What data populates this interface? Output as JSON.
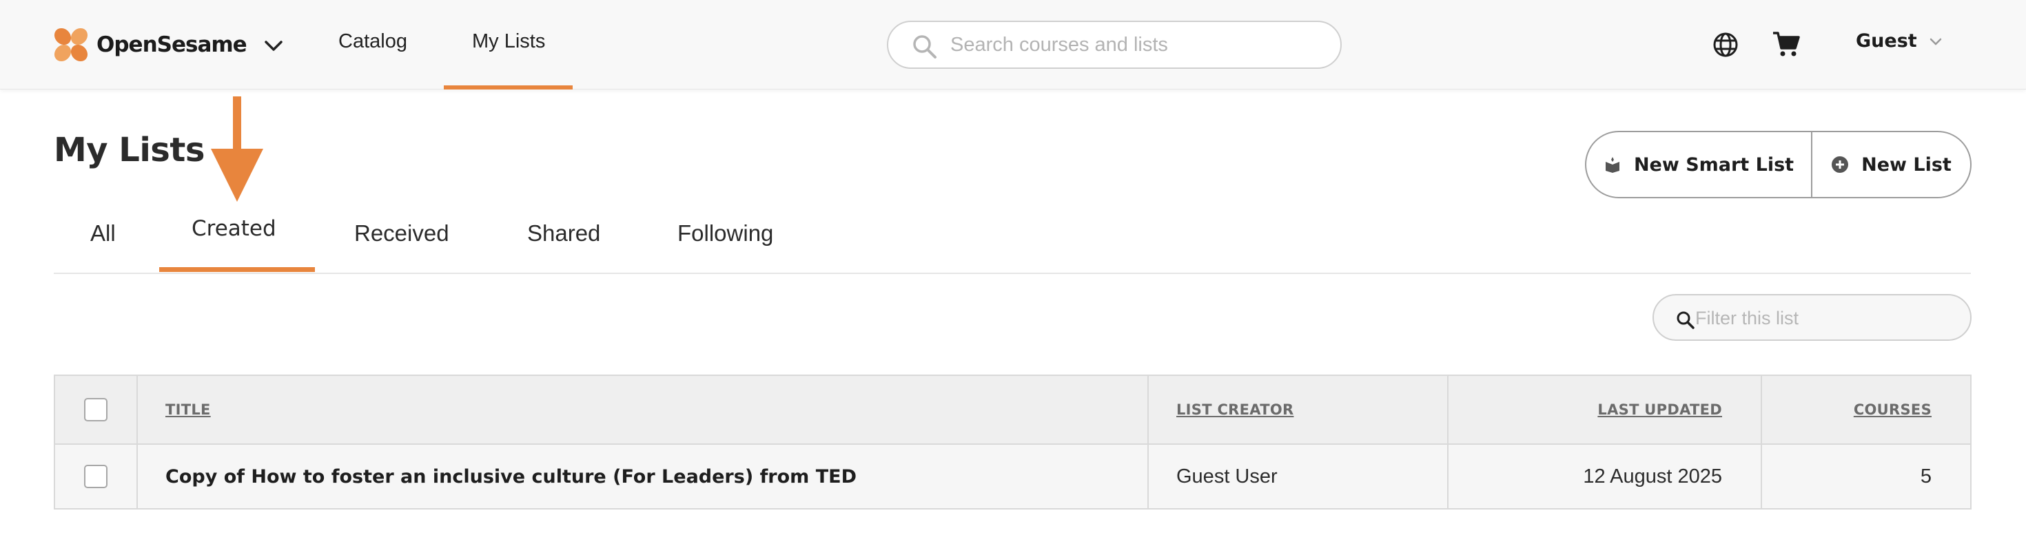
{
  "header": {
    "brand": "OpenSesame",
    "nav": {
      "catalog": "Catalog",
      "my_lists": "My Lists"
    },
    "search": {
      "placeholder": "Search courses and lists",
      "value": ""
    },
    "user": {
      "name": "Guest"
    },
    "colors": {
      "accent": "#e8853d"
    },
    "icons": [
      "opensesame-logo",
      "chevron-down-icon",
      "search-icon",
      "globe-icon",
      "cart-icon"
    ]
  },
  "page": {
    "title": "My Lists",
    "actions": {
      "new_smart_list": "New Smart List",
      "new_list": "New List"
    },
    "tabs": {
      "all": "All",
      "created": "Created",
      "received": "Received",
      "shared": "Shared",
      "following": "Following",
      "active": "Created"
    },
    "filter": {
      "placeholder": "Filter this list",
      "value": ""
    }
  },
  "table": {
    "columns": {
      "title": "TITLE",
      "creator": "LIST CREATOR",
      "updated": "LAST UPDATED",
      "courses": "COURSES"
    },
    "rows": [
      {
        "title": "Copy of How to foster an inclusive culture (For Leaders) from TED",
        "creator": "Guest User",
        "updated": "12 August 2025",
        "courses": "5",
        "checked": false
      }
    ]
  }
}
